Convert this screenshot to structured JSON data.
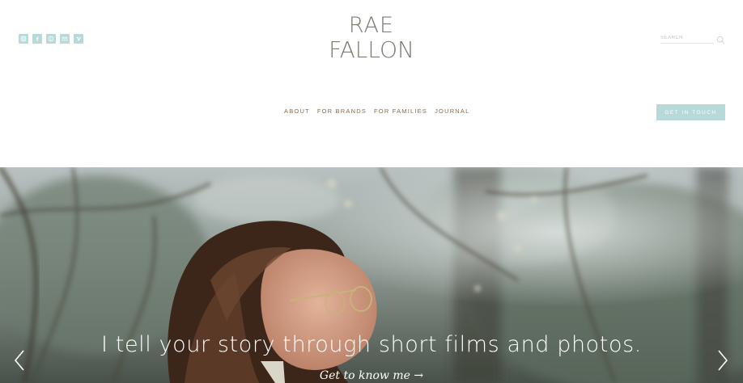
{
  "brand": {
    "logo_line1": "RAE",
    "logo_line2": "FALLON"
  },
  "social": [
    {
      "icon": "instagram-icon"
    },
    {
      "icon": "facebook-icon"
    },
    {
      "icon": "pinterest-icon"
    },
    {
      "icon": "email-icon"
    },
    {
      "icon": "vimeo-icon"
    }
  ],
  "search": {
    "placeholder": "SEARCH",
    "icon": "search-icon"
  },
  "nav": {
    "items": [
      {
        "label": "ABOUT"
      },
      {
        "label": "FOR BRANDS"
      },
      {
        "label": "FOR FAMILIES"
      },
      {
        "label": "JOURNAL"
      }
    ]
  },
  "cta": {
    "label": "GET IN TOUCH"
  },
  "hero": {
    "headline": "I tell your story through short films and photos.",
    "link": "Get to know me →",
    "prev_icon": "chevron-left-icon",
    "next_icon": "chevron-right-icon"
  },
  "colors": {
    "accent": "#b7d9d9",
    "nav_text": "#8a6a4b",
    "logo": "#7d7a72"
  }
}
